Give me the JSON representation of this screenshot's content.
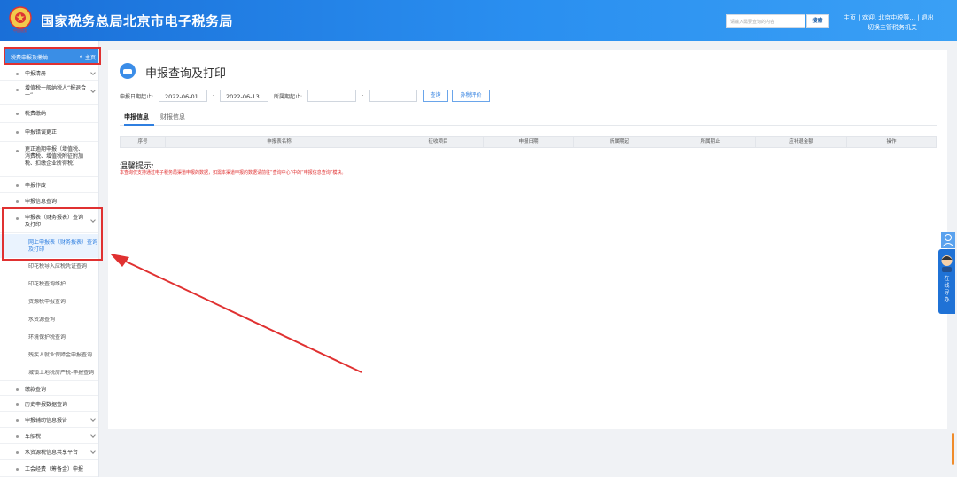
{
  "header": {
    "title": "国家税务总局北京市电子税务局",
    "logo_text": "中国税务",
    "search_placeholder": "请输入需要查询的内容",
    "search_button": "搜索",
    "link_home": "主页",
    "welcome": "欢迎, 北京中税等...",
    "logout": "退出",
    "switch_org": "切换主管税务机关"
  },
  "sidebar": {
    "header_title": "税费申报及缴纳",
    "home_link": "主页",
    "items": [
      {
        "label": "申报清册",
        "chevron": true
      },
      {
        "label": "增值税一般纳税人“报退合一”",
        "chevron": true
      },
      {
        "label": "税费缴纳",
        "chevron": false
      },
      {
        "label": "申报错误更正",
        "chevron": false
      },
      {
        "label": "更正逾期申报（增值税、消费税、增值税附征附加税、扣缴企业所得税）",
        "chevron": false
      },
      {
        "label": "申报作废",
        "chevron": false
      },
      {
        "label": "申报信息查询",
        "chevron": false
      },
      {
        "label": "申报表（财务报表）查询及打印",
        "chevron": true
      }
    ],
    "subitems": [
      "网上申报表（财务报表）查询及打印",
      "印花税导入应税凭证查询",
      "印花税查询维护",
      "资源税申报查询",
      "水资源查询",
      "环境保护税查询",
      "残疾人就业保障金申报查询",
      "城镇土地税房产税-申报查询"
    ],
    "items_bottom": [
      {
        "label": "缴款查询",
        "chevron": false
      },
      {
        "label": "历史申报数据查询",
        "chevron": false
      },
      {
        "label": "申报辅助信息报告",
        "chevron": true
      },
      {
        "label": "车船税",
        "chevron": true
      },
      {
        "label": "水资源税信息共享平台",
        "chevron": true
      },
      {
        "label": "工会经费（筹备金）申报",
        "chevron": false
      }
    ]
  },
  "main": {
    "page_title": "申报查询及打印",
    "filters": {
      "date_label": "申报日期起止:",
      "date_start": "2022-06-01",
      "date_end": "2022-06-13",
      "period_label": "所属期起止:",
      "period_start": "",
      "period_end": "",
      "separator": "-",
      "query_button": "查询",
      "rating_button": "办税评价"
    },
    "tabs": [
      {
        "label": "申报信息",
        "active": true
      },
      {
        "label": "财报信息",
        "active": false
      }
    ],
    "table_headers": [
      "序号",
      "申报表名称",
      "征收项目",
      "申报日期",
      "所属期起",
      "所属期止",
      "应补退金额",
      "操作"
    ],
    "tip_title": "温馨提示:",
    "tip_text": "本查询仅支持通过电子税务局渠道申报的数据，如需本渠道申报的数据请前往“查询中心”中的“申报信息查询”模块。"
  },
  "float": {
    "customer_service": "在线导办"
  },
  "colors": {
    "header": "#2a8ff0",
    "accent": "#2f7fe0",
    "annotation_red": "#e03131"
  }
}
